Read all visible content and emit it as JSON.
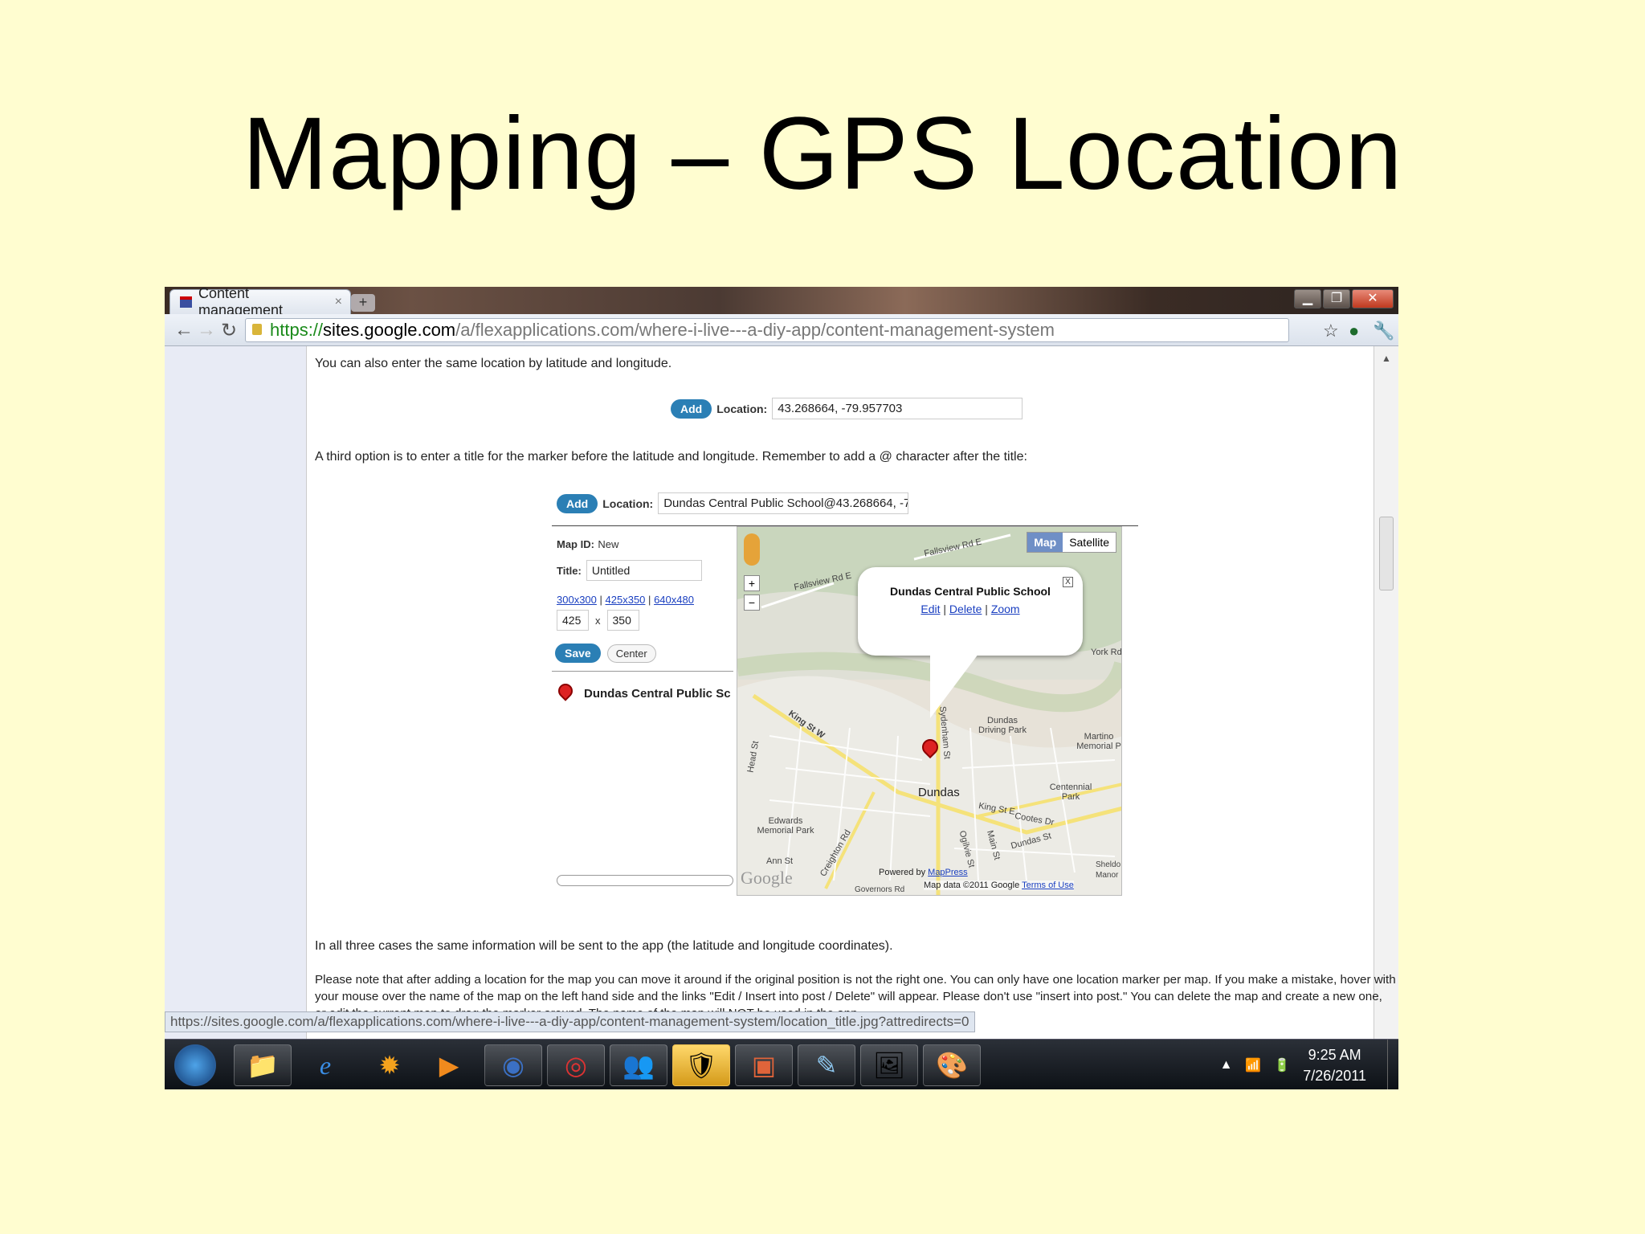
{
  "slide": {
    "title": "Mapping – GPS Location"
  },
  "browser": {
    "tab_title": "Content management",
    "tab_close": "×",
    "new_tab": "+",
    "url_scheme": "https://",
    "url_host": "sites.google.com",
    "url_path": "/a/flexapplications.com/where-i-live---a-diy-app/content-management-system",
    "status_url": "https://sites.google.com/a/flexapplications.com/where-i-live---a-diy-app/content-management-system/location_title.jpg?attredirects=0"
  },
  "page": {
    "intro": "You can also enter the same location by latitude and longitude.",
    "example1": {
      "button": "Add",
      "label": "Location:",
      "value": "43.268664, -79.957703"
    },
    "third_option": "A third option is to enter a title for the marker before the latitude and longitude. Remember to add a @ character after the title:",
    "example2": {
      "button": "Add",
      "label": "Location:",
      "value": "Dundas Central Public School@43.268664, -7"
    },
    "all_cases": "In all three cases the same information will be sent to the app (the latitude and longitude coordinates).",
    "note_line1": "Please note that after adding a location for the map you can move it around if the original position is not the right one. You can only have one location marker per map. If you make a mistake, hover with",
    "note_line2": "your mouse over the name of the map on the left hand side and the links \"Edit / Insert into post / Delete\" will appear. Please don't use \"insert into post.\" You can delete the map and create a new one,",
    "note_line3": "or edit the current map to drag the marker around. The name of the map will NOT be used in the app."
  },
  "editor": {
    "map_id_label": "Map ID:",
    "map_id_value": "New",
    "title_label": "Title:",
    "title_value": "Untitled",
    "size_300": "300x300",
    "size_425": "425x350",
    "size_640": "640x480",
    "sep": "|",
    "width": "425",
    "times": "x",
    "height": "350",
    "save": "Save",
    "center": "Center",
    "marker_name": "Dundas Central Public Sc"
  },
  "map": {
    "type_map": "Map",
    "type_satellite": "Satellite",
    "bubble_title": "Dundas Central Public School",
    "link_edit": "Edit",
    "link_delete": "Delete",
    "link_zoom": "Zoom",
    "link_sep": "|",
    "bubble_close": "X",
    "labels": {
      "falls1": "Fallsview Rd E",
      "falls2": "Fallsview Rd E",
      "york": "York Rd",
      "king_w": "King St W",
      "driving": "Dundas Driving Park",
      "martino": "Martino Memorial P",
      "head": "Head St",
      "sydenham": "Sydenham St",
      "dundas": "Dundas",
      "centennial": "Centennial Park",
      "king_e": "King St E",
      "cootes": "Cootes Dr",
      "edwards": "Edwards Memorial Park",
      "main": "Main St",
      "dundas_st": "Dundas St",
      "ogilvie": "Ogilvie St",
      "creighton": "Creighton Rd",
      "ann": "Ann St",
      "governors": "Governors Rd",
      "sheldon": "Sheldo",
      "manor": "Manor"
    },
    "powered": "Powered by",
    "mappress": "MapPress",
    "attribution": "Map data ©2011 Google",
    "terms": "Terms of Use",
    "google": "Google",
    "zoom_in": "+",
    "zoom_out": "−"
  },
  "taskbar": {
    "time": "9:25 AM",
    "date": "7/26/2011"
  }
}
